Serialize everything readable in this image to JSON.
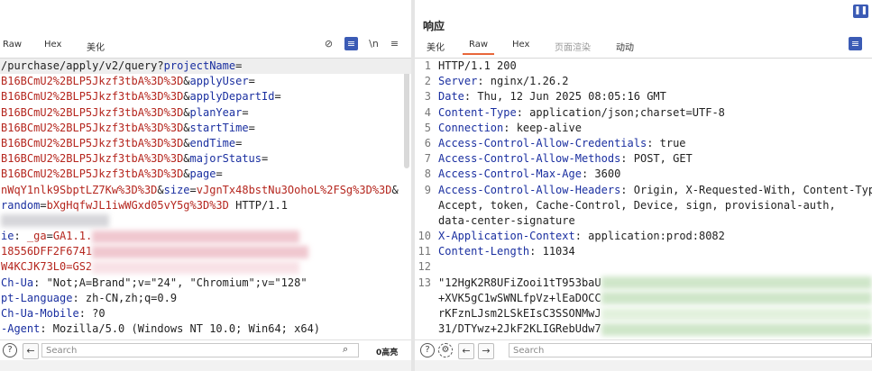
{
  "request": {
    "tabs": [
      {
        "label": "Raw"
      },
      {
        "label": "Hex"
      },
      {
        "label": "美化"
      }
    ],
    "lines": [
      [
        {
          "t": "p",
          "v": "/purchase/apply/v2/query?"
        },
        {
          "t": "k",
          "v": "projectName"
        },
        {
          "t": "p",
          "v": "="
        }
      ],
      [
        {
          "t": "v",
          "v": "B16BCmU2%2BLP5Jkzf3tbA%3D%3D"
        },
        {
          "t": "p",
          "v": "&"
        },
        {
          "t": "k",
          "v": "applyUser"
        },
        {
          "t": "p",
          "v": "="
        }
      ],
      [
        {
          "t": "v",
          "v": "B16BCmU2%2BLP5Jkzf3tbA%3D%3D"
        },
        {
          "t": "p",
          "v": "&"
        },
        {
          "t": "k",
          "v": "applyDepartId"
        },
        {
          "t": "p",
          "v": "="
        }
      ],
      [
        {
          "t": "v",
          "v": "B16BCmU2%2BLP5Jkzf3tbA%3D%3D"
        },
        {
          "t": "p",
          "v": "&"
        },
        {
          "t": "k",
          "v": "planYear"
        },
        {
          "t": "p",
          "v": "="
        }
      ],
      [
        {
          "t": "v",
          "v": "B16BCmU2%2BLP5Jkzf3tbA%3D%3D"
        },
        {
          "t": "p",
          "v": "&"
        },
        {
          "t": "k",
          "v": "startTime"
        },
        {
          "t": "p",
          "v": "="
        }
      ],
      [
        {
          "t": "v",
          "v": "B16BCmU2%2BLP5Jkzf3tbA%3D%3D"
        },
        {
          "t": "p",
          "v": "&"
        },
        {
          "t": "k",
          "v": "endTime"
        },
        {
          "t": "p",
          "v": "="
        }
      ],
      [
        {
          "t": "v",
          "v": "B16BCmU2%2BLP5Jkzf3tbA%3D%3D"
        },
        {
          "t": "p",
          "v": "&"
        },
        {
          "t": "k",
          "v": "majorStatus"
        },
        {
          "t": "p",
          "v": "="
        }
      ],
      [
        {
          "t": "v",
          "v": "B16BCmU2%2BLP5Jkzf3tbA%3D%3D"
        },
        {
          "t": "p",
          "v": "&"
        },
        {
          "t": "k",
          "v": "page"
        },
        {
          "t": "p",
          "v": "="
        }
      ],
      [
        {
          "t": "v",
          "v": "nWqY1nlk9SbptLZ7Kw%3D%3D"
        },
        {
          "t": "p",
          "v": "&"
        },
        {
          "t": "k",
          "v": "size"
        },
        {
          "t": "p",
          "v": "="
        },
        {
          "t": "v",
          "v": "vJgnTx48bstNu3OohoL%2FSg%3D%3D"
        },
        {
          "t": "p",
          "v": "&"
        }
      ],
      [
        {
          "t": "k",
          "v": "random"
        },
        {
          "t": "p",
          "v": "="
        },
        {
          "t": "v",
          "v": "bXgHqfwJL1iwWGxd05vY5g%3D%3D"
        },
        {
          "t": "p",
          "v": " HTTP/1.1"
        }
      ],
      [
        {
          "t": "blur",
          "c": "gray",
          "w": 120
        }
      ],
      [
        {
          "t": "k",
          "v": "ie"
        },
        {
          "t": "p",
          "v": ": "
        },
        {
          "t": "v",
          "v": "_ga"
        },
        {
          "t": "p",
          "v": "="
        },
        {
          "t": "v",
          "v": "GA1.1."
        },
        {
          "t": "blur",
          "c": "pink",
          "w": 230
        }
      ],
      [
        {
          "t": "v",
          "v": "18556DFF2F6741"
        },
        {
          "t": "blur",
          "c": "pink",
          "w": 240
        }
      ],
      [
        {
          "t": "v",
          "v": "W4KCJK73L0=GS2"
        },
        {
          "t": "blur",
          "c": "lpink",
          "w": 230
        }
      ],
      [
        {
          "t": "k",
          "v": "Ch-Ua"
        },
        {
          "t": "p",
          "v": ": \"Not;A=Brand\";v=\"24\", \"Chromium\";v=\"128\""
        }
      ],
      [
        {
          "t": "k",
          "v": "pt-Language"
        },
        {
          "t": "p",
          "v": ": zh-CN,zh;q=0.9"
        }
      ],
      [
        {
          "t": "k",
          "v": "Ch-Ua-Mobile"
        },
        {
          "t": "p",
          "v": ": ?0"
        }
      ],
      [
        {
          "t": "k",
          "v": "-Agent"
        },
        {
          "t": "p",
          "v": ": Mozilla/5.0 (Windows NT 10.0; Win64; x64)"
        }
      ]
    ],
    "search_placeholder": "Search",
    "hits": "0高亮"
  },
  "response": {
    "title": "响应",
    "tabs": [
      {
        "label": "美化"
      },
      {
        "label": "Raw"
      },
      {
        "label": "Hex"
      },
      {
        "label": "页面渲染"
      },
      {
        "label": "动动"
      }
    ],
    "lines": [
      {
        "n": "1",
        "parts": [
          {
            "t": "p",
            "v": "HTTP/1.1 200"
          }
        ]
      },
      {
        "n": "2",
        "parts": [
          {
            "t": "k",
            "v": "Server"
          },
          {
            "t": "p",
            "v": ": nginx/1.26.2"
          }
        ]
      },
      {
        "n": "3",
        "parts": [
          {
            "t": "k",
            "v": "Date"
          },
          {
            "t": "p",
            "v": ": Thu, 12 Jun 2025 08:05:16 GMT"
          }
        ]
      },
      {
        "n": "4",
        "parts": [
          {
            "t": "k",
            "v": "Content-Type"
          },
          {
            "t": "p",
            "v": ": application/json;charset=UTF-8"
          }
        ]
      },
      {
        "n": "5",
        "parts": [
          {
            "t": "k",
            "v": "Connection"
          },
          {
            "t": "p",
            "v": ": keep-alive"
          }
        ]
      },
      {
        "n": "6",
        "parts": [
          {
            "t": "k",
            "v": "Access-Control-Allow-Credentials"
          },
          {
            "t": "p",
            "v": ": true"
          }
        ]
      },
      {
        "n": "7",
        "parts": [
          {
            "t": "k",
            "v": "Access-Control-Allow-Methods"
          },
          {
            "t": "p",
            "v": ": POST, GET"
          }
        ]
      },
      {
        "n": "8",
        "parts": [
          {
            "t": "k",
            "v": "Access-Control-Max-Age"
          },
          {
            "t": "p",
            "v": ": 3600"
          }
        ]
      },
      {
        "n": "9",
        "parts": [
          {
            "t": "k",
            "v": "Access-Control-Allow-Headers"
          },
          {
            "t": "p",
            "v": ": Origin, X-Requested-With, Content-Typ"
          }
        ]
      },
      {
        "n": "",
        "parts": [
          {
            "t": "p",
            "v": "Accept, token, Cache-Control, Device, sign, provisional-auth,"
          }
        ]
      },
      {
        "n": "",
        "parts": [
          {
            "t": "p",
            "v": "data-center-signature"
          }
        ]
      },
      {
        "n": "10",
        "parts": [
          {
            "t": "k",
            "v": "X-Application-Context"
          },
          {
            "t": "p",
            "v": ": application:prod:8082"
          }
        ]
      },
      {
        "n": "11",
        "parts": [
          {
            "t": "k",
            "v": "Content-Length"
          },
          {
            "t": "p",
            "v": ": 11034"
          }
        ]
      },
      {
        "n": "12",
        "parts": []
      },
      {
        "n": "13",
        "parts": [
          {
            "t": "g",
            "v": "\"12HgK2R8UFiZooi1tT953baU"
          },
          {
            "t": "blur",
            "c": "green",
            "w": 300
          }
        ]
      },
      {
        "n": "",
        "parts": [
          {
            "t": "g",
            "v": "+XVK5gC1wSWNLfpVz+lEaDOCC"
          },
          {
            "t": "blur",
            "c": "green",
            "w": 300
          }
        ]
      },
      {
        "n": "",
        "parts": [
          {
            "t": "g",
            "v": "rKFznLJsm2LSkEIsC3SSONMwJ"
          },
          {
            "t": "blur",
            "c": "lgreen",
            "w": 300
          }
        ]
      },
      {
        "n": "",
        "parts": [
          {
            "t": "g",
            "v": "31/DTYwz+2JkF2KLIGRebUdw7"
          },
          {
            "t": "blur",
            "c": "green",
            "w": 300
          }
        ]
      }
    ],
    "search_placeholder": "Search"
  }
}
